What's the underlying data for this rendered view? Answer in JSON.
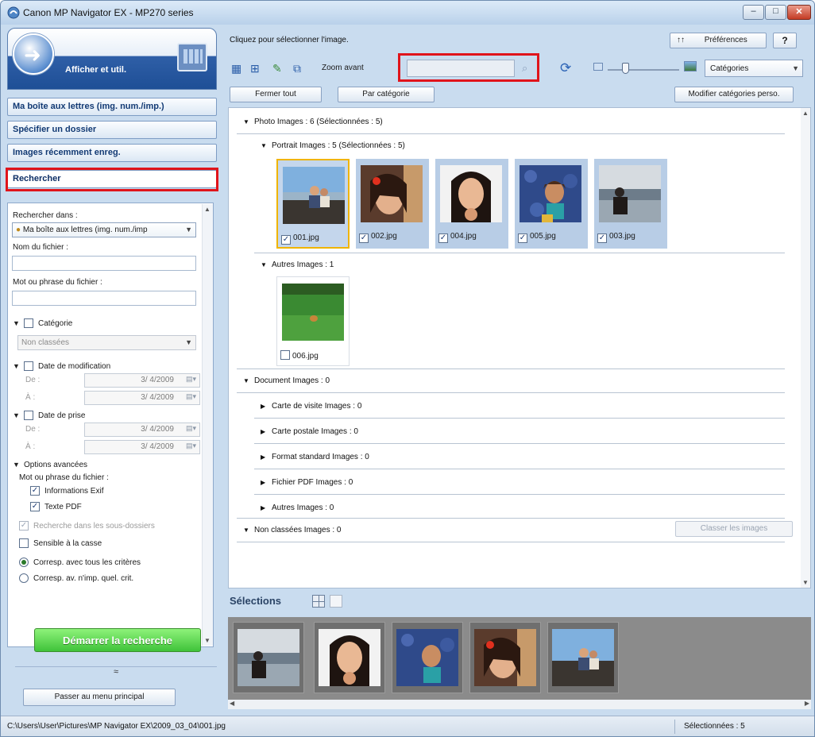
{
  "window": {
    "title": "Canon MP Navigator EX - MP270 series"
  },
  "left": {
    "header_title": "Afficher et util.",
    "nav": [
      {
        "label": "Ma boîte aux lettres (img. num./imp.)"
      },
      {
        "label": "Spécifier un dossier"
      },
      {
        "label": "Images récemment enreg."
      },
      {
        "label": "Rechercher"
      }
    ],
    "search": {
      "search_in_label": "Rechercher dans :",
      "search_in_value": "Ma boîte aux lettres (img. num./imp",
      "filename_label": "Nom du fichier :",
      "filename_value": "",
      "phrase_label": "Mot ou phrase du fichier :",
      "phrase_value": "",
      "category_label": "Catégorie",
      "category_value": "Non classées",
      "modified_label": "Date de modification",
      "from_label": "De :",
      "to_label": "À :",
      "modified_from": "3/ 4/2009",
      "modified_to": "3/ 4/2009",
      "taken_label": "Date de prise",
      "taken_from": "3/ 4/2009",
      "taken_to": "3/ 4/2009",
      "advanced_label": "Options avancées",
      "advanced_sub_label": "Mot ou phrase du fichier :",
      "exif_label": "Informations Exif",
      "pdf_label": "Texte PDF",
      "subfolders_label": "Recherche dans les sous-dossiers",
      "case_label": "Sensible à la casse",
      "match_all_label": "Corresp. avec tous les critères",
      "match_any_label": "Corresp. av. n'imp. quel. crit."
    },
    "start_button": "Démarrer la recherche",
    "collapse_glyph": "≈",
    "main_menu_button": "Passer au menu principal"
  },
  "toolbar": {
    "hint": "Cliquez pour sélectionner l'image.",
    "preferences": "Préférences",
    "help": "?",
    "zoom_in": "Zoom avant",
    "search_value": "",
    "category_select": "Catégories",
    "close_all": "Fermer tout",
    "by_category": "Par catégorie",
    "edit_categories": "Modifier catégories perso."
  },
  "tree": {
    "photo": "Photo   Images : 6   (Sélectionnées : 5)",
    "portrait": "Portrait   Images : 5   (Sélectionnées : 5)",
    "autres_photo": "Autres   Images : 1",
    "document": "Document   Images : 0",
    "carte_visite": "Carte de visite   Images : 0",
    "carte_postale": "Carte postale   Images : 0",
    "format_standard": "Format standard   Images : 0",
    "fichier_pdf": "Fichier PDF   Images : 0",
    "autres_doc": "Autres   Images : 0",
    "non_classees": "Non classées   Images : 0",
    "classify_button": "Classer les images"
  },
  "thumbnails": [
    {
      "file": "001.jpg",
      "checked": true
    },
    {
      "file": "002.jpg",
      "checked": true
    },
    {
      "file": "004.jpg",
      "checked": true
    },
    {
      "file": "005.jpg",
      "checked": true
    },
    {
      "file": "003.jpg",
      "checked": true
    }
  ],
  "other_thumbnail": {
    "file": "006.jpg",
    "checked": false
  },
  "selections": {
    "title": "Sélections"
  },
  "status": {
    "path": "C:\\Users\\User\\Pictures\\MP Navigator EX\\2009_03_04\\001.jpg",
    "selected": "Sélectionnées : 5"
  },
  "colors": {
    "highlight_red": "#e0141b",
    "selection_gold": "#f0b400",
    "start_button_green": "#3fc33a"
  }
}
